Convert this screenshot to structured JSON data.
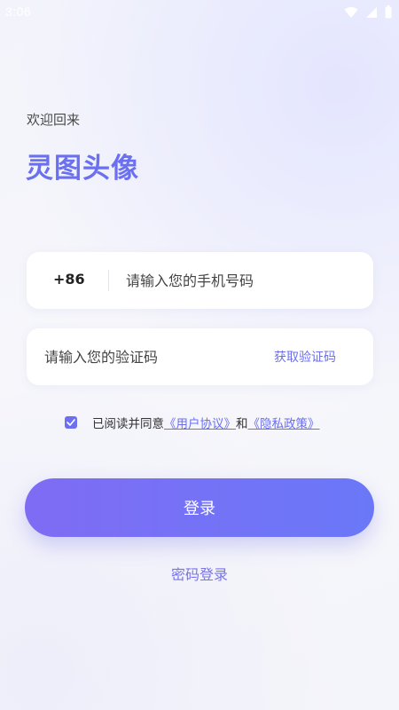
{
  "status_bar": {
    "time": "3:06",
    "icons": [
      "wifi-icon",
      "signal-icon",
      "battery-icon"
    ]
  },
  "header": {
    "welcome": "欢迎回来",
    "app_name": "灵图头像"
  },
  "phone_field": {
    "prefix": "+86",
    "placeholder": "请输入您的手机号码",
    "value": ""
  },
  "code_field": {
    "placeholder": "请输入您的验证码",
    "value": "",
    "get_code_label": "获取验证码"
  },
  "agreement": {
    "checked": true,
    "prefix_text": "已阅读并同意",
    "user_agreement": "《用户协议》",
    "and_text": "和",
    "privacy_policy": "《隐私政策》"
  },
  "actions": {
    "login_label": "登录",
    "password_login_label": "密码登录"
  },
  "colors": {
    "accent": "#6b70f0",
    "button_gradient_start": "#7f6cf4",
    "button_gradient_end": "#6a78f8",
    "background": "#f4f5fa"
  }
}
